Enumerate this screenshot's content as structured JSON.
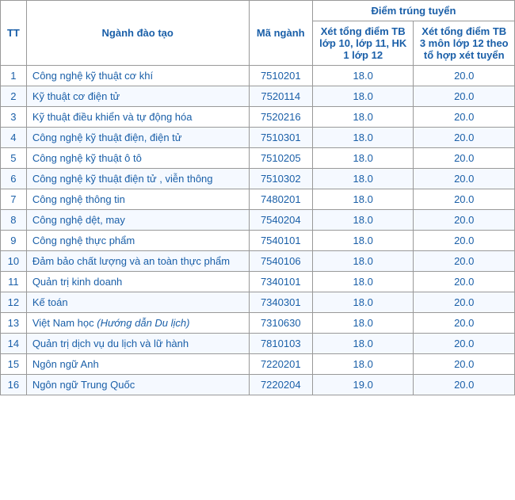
{
  "table": {
    "header": {
      "tt": "TT",
      "nganh": "Ngành đào tạo",
      "ma_nganh": "Mã ngành",
      "diem_trung_tuyen": "Điểm trúng tuyển",
      "col1": "Xét tổng điểm TB lớp 10, lớp 11, HK 1 lớp 12",
      "col2": "Xét tổng điểm TB 3 môn lớp 12 theo tổ hợp xét tuyển"
    },
    "rows": [
      {
        "tt": "1",
        "nganh": "Công nghệ kỹ thuật cơ khí",
        "ma": "7510201",
        "score1": "18.0",
        "score2": "20.0",
        "italic": false
      },
      {
        "tt": "2",
        "nganh": "Kỹ thuật cơ điện tử",
        "ma": "7520114",
        "score1": "18.0",
        "score2": "20.0",
        "italic": false
      },
      {
        "tt": "3",
        "nganh": "Kỹ thuật điều khiển và tự động hóa",
        "ma": "7520216",
        "score1": "18.0",
        "score2": "20.0",
        "italic": false
      },
      {
        "tt": "4",
        "nganh": "Công nghệ kỹ thuật điện, điện tử",
        "ma": "7510301",
        "score1": "18.0",
        "score2": "20.0",
        "italic": false
      },
      {
        "tt": "5",
        "nganh": "Công nghệ kỹ thuật ô tô",
        "ma": "7510205",
        "score1": "18.0",
        "score2": "20.0",
        "italic": false
      },
      {
        "tt": "6",
        "nganh": "Công nghệ kỹ thuật điện tử , viễn thông",
        "ma": "7510302",
        "score1": "18.0",
        "score2": "20.0",
        "italic": false
      },
      {
        "tt": "7",
        "nganh": "Công nghệ thông tin",
        "ma": "7480201",
        "score1": "18.0",
        "score2": "20.0",
        "italic": false
      },
      {
        "tt": "8",
        "nganh": "Công nghệ dệt, may",
        "ma": "7540204",
        "score1": "18.0",
        "score2": "20.0",
        "italic": false
      },
      {
        "tt": "9",
        "nganh": "Công nghệ thực phẩm",
        "ma": "7540101",
        "score1": "18.0",
        "score2": "20.0",
        "italic": false
      },
      {
        "tt": "10",
        "nganh": "Đảm bảo chất lượng và an toàn thực phẩm",
        "ma": "7540106",
        "score1": "18.0",
        "score2": "20.0",
        "italic": false
      },
      {
        "tt": "11",
        "nganh": "Quản trị kinh doanh",
        "ma": "7340101",
        "score1": "18.0",
        "score2": "20.0",
        "italic": false
      },
      {
        "tt": "12",
        "nganh": "Kế toán",
        "ma": "7340301",
        "score1": "18.0",
        "score2": "20.0",
        "italic": false
      },
      {
        "tt": "13",
        "nganh": "Việt Nam học",
        "nganh_italic": "(Hướng dẫn Du lịch)",
        "ma": "7310630",
        "score1": "18.0",
        "score2": "20.0",
        "italic": true
      },
      {
        "tt": "14",
        "nganh": "Quản trị dịch vụ du lịch và lữ hành",
        "ma": "7810103",
        "score1": "18.0",
        "score2": "20.0",
        "italic": false
      },
      {
        "tt": "15",
        "nganh": "Ngôn ngữ Anh",
        "ma": "7220201",
        "score1": "18.0",
        "score2": "20.0",
        "italic": false
      },
      {
        "tt": "16",
        "nganh": "Ngôn ngữ Trung Quốc",
        "ma": "7220204",
        "score1": "19.0",
        "score2": "20.0",
        "italic": false
      }
    ]
  }
}
